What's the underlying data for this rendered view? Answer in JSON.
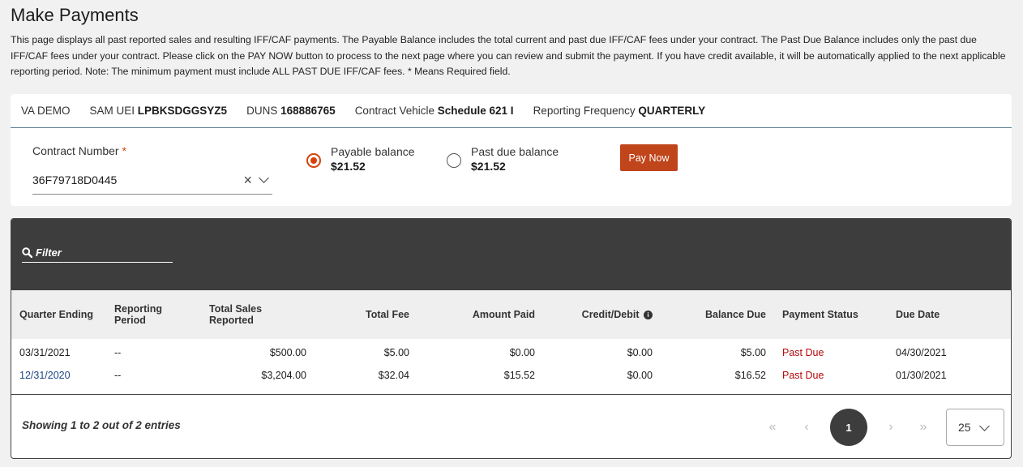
{
  "page": {
    "title": "Make Payments",
    "description": "This page displays all past reported sales and resulting IFF/CAF payments. The Payable Balance includes the total current and past due IFF/CAF fees under your contract. The Past Due Balance includes only the past due IFF/CAF fees under your contract. Please click on the PAY NOW button to process to the next page where you can review and submit the payment. If you have credit available, it will be automatically applied to the next applicable reporting period. Note: The minimum payment must include ALL PAST DUE IFF/CAF fees. * Means Required field."
  },
  "info_bar": {
    "vendor": "VA DEMO",
    "sam_uei_label": "SAM UEI",
    "sam_uei_value": "LPBKSDGGSYZ5",
    "duns_label": "DUNS",
    "duns_value": "168886765",
    "contract_vehicle_label": "Contract Vehicle",
    "contract_vehicle_value": "Schedule 621 I",
    "reporting_frequency_label": "Reporting Frequency",
    "reporting_frequency_value": "QUARTERLY"
  },
  "contract": {
    "label": "Contract Number",
    "required_marker": "*",
    "value": "36F79718D0445",
    "clear_glyph": "×"
  },
  "balances": {
    "payable_label": "Payable balance",
    "payable_amount": "$21.52",
    "past_due_label": "Past due balance",
    "past_due_amount": "$21.52",
    "selected": "payable"
  },
  "pay_now_label": "Pay Now",
  "filter": {
    "placeholder": "Filter",
    "icon": "search-icon"
  },
  "table": {
    "headers": {
      "quarter_ending": "Quarter Ending",
      "reporting_period": "Reporting Period",
      "total_sales": "Total Sales Reported",
      "total_fee": "Total Fee",
      "amount_paid": "Amount Paid",
      "credit_debit": "Credit/Debit",
      "balance_due": "Balance Due",
      "payment_status": "Payment Status",
      "due_date": "Due Date"
    },
    "rows": [
      {
        "quarter_ending": "03/31/2021",
        "reporting_period": "--",
        "total_sales": "$500.00",
        "total_fee": "$5.00",
        "amount_paid": "$0.00",
        "credit_debit": "$0.00",
        "balance_due": "$5.00",
        "payment_status": "Past Due",
        "due_date": "04/30/2021"
      },
      {
        "quarter_ending": "12/31/2020",
        "reporting_period": "--",
        "total_sales": "$3,204.00",
        "total_fee": "$32.04",
        "amount_paid": "$15.52",
        "credit_debit": "$0.00",
        "balance_due": "$16.52",
        "payment_status": "Past Due",
        "due_date": "01/30/2021"
      }
    ]
  },
  "footer": {
    "entries_text": "Showing 1 to 2 out of 2 entries",
    "first": "«",
    "prev": "‹",
    "current_page": "1",
    "next": "›",
    "last": "»",
    "page_size": "25"
  },
  "colors": {
    "accent": "#d54309",
    "pay_button": "#c0451b",
    "past_due": "#b50909",
    "link": "#1a4480",
    "grid_header": "#3d3d3d"
  }
}
